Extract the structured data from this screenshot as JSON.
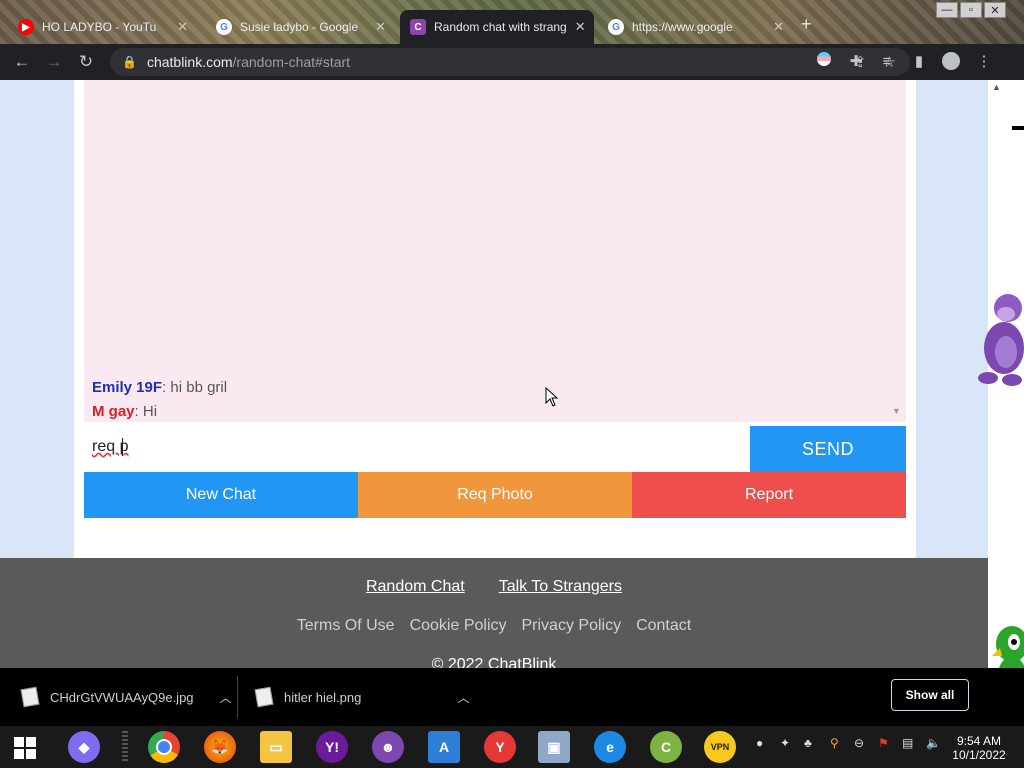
{
  "browser": {
    "tabs": [
      {
        "title": "HO LADYBO - YouTu",
        "favicon": "youtube-icon",
        "color": "#ff0000",
        "glyph": "▶"
      },
      {
        "title": "Susie ladybo - Google",
        "favicon": "google-icon",
        "color": "#4285f4",
        "glyph": "G"
      },
      {
        "title": "Random chat with strang",
        "favicon": "chatblink-icon",
        "color": "#8e44ad",
        "glyph": "C"
      },
      {
        "title": "https://www.google",
        "favicon": "google-icon",
        "color": "#4285f4",
        "glyph": "G"
      }
    ],
    "url_domain": "chatblink.com",
    "url_path": "/random-chat#start"
  },
  "chat": {
    "messages": [
      {
        "name": "Emily 19F",
        "text": "hi bb gril"
      },
      {
        "name": "M gay",
        "text": "Hi"
      }
    ],
    "input_value": "req p",
    "send_label": "SEND",
    "new_chat_label": "New Chat",
    "req_photo_label": "Req Photo",
    "report_label": "Report"
  },
  "footer": {
    "link_random_chat": "Random Chat",
    "link_talk_strangers": "Talk To Strangers",
    "terms": "Terms Of Use",
    "cookie": "Cookie Policy",
    "privacy": "Privacy Policy",
    "contact": "Contact",
    "copyright": "© 2022 ChatBlink"
  },
  "downloads": {
    "items": [
      "CHdrGtVWUAAyQ9e.jpg",
      "hitler hiel.png"
    ],
    "show_all": "Show all"
  },
  "taskbar": {
    "time": "9:54 AM",
    "date": "10/1/2022"
  },
  "colors": {
    "send": "#2196f3",
    "new_chat": "#2196f3",
    "req_photo": "#f0963c",
    "report": "#ee4f4c",
    "footer": "#5a5a5a",
    "chat_bg": "#fbe9f2"
  }
}
